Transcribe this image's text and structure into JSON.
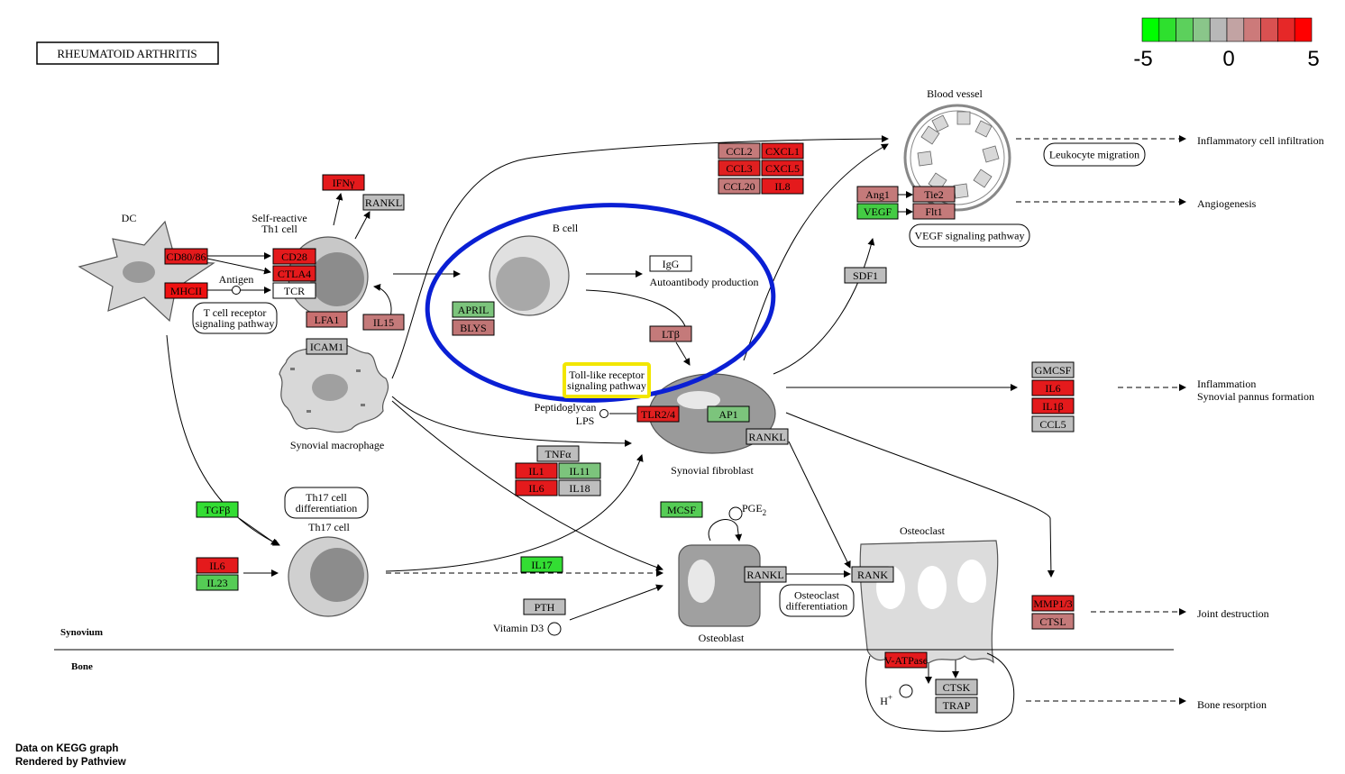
{
  "title": "RHEUMATOID  ARTHRITIS",
  "colorbar": {
    "colors": [
      "#00ff00",
      "#2ee02e",
      "#5cd05c",
      "#8ac68a",
      "#b8b8b8",
      "#c2a3a3",
      "#cc7a7a",
      "#d95151",
      "#e62828",
      "#ff0000"
    ],
    "ticks": [
      "-5",
      "0",
      "5"
    ]
  },
  "genes": [
    {
      "id": "cd80",
      "label": "CD80/86",
      "color": "#e41a1c"
    },
    {
      "id": "mhcii",
      "label": "MHCII",
      "color": "#ee1111"
    },
    {
      "id": "cd28",
      "label": "CD28",
      "color": "#e41a1c"
    },
    {
      "id": "ctla4",
      "label": "CTLA4",
      "color": "#e41a1c"
    },
    {
      "id": "tcr",
      "label": "TCR",
      "color": "#ffffff"
    },
    {
      "id": "ifng",
      "label": "IFNγ",
      "color": "#e41a1c"
    },
    {
      "id": "rankl1",
      "label": "RANKL",
      "color": "#bebebe"
    },
    {
      "id": "lfa1",
      "label": "LFA1",
      "color": "#c87070"
    },
    {
      "id": "il15",
      "label": "IL15",
      "color": "#c47a7a"
    },
    {
      "id": "icam1",
      "label": "ICAM1",
      "color": "#bebebe"
    },
    {
      "id": "april",
      "label": "APRIL",
      "color": "#7cc47c"
    },
    {
      "id": "blys",
      "label": "BLYS",
      "color": "#c07575"
    },
    {
      "id": "igg",
      "label": "IgG",
      "color": "#ffffff"
    },
    {
      "id": "ltb",
      "label": "LTβ",
      "color": "#c47a7a"
    },
    {
      "id": "ccl2",
      "label": "CCL2",
      "color": "#c47a7a"
    },
    {
      "id": "cxcl1",
      "label": "CXCL1",
      "color": "#e41a1c"
    },
    {
      "id": "ccl3",
      "label": "CCL3",
      "color": "#e02020"
    },
    {
      "id": "cxcl5",
      "label": "CXCL5",
      "color": "#e41a1c"
    },
    {
      "id": "ccl20",
      "label": "CCL20",
      "color": "#c47a7a"
    },
    {
      "id": "il8",
      "label": "IL8",
      "color": "#e41a1c"
    },
    {
      "id": "ang1",
      "label": "Ang1",
      "color": "#c47a7a"
    },
    {
      "id": "tie2",
      "label": "Tie2",
      "color": "#c47a7a"
    },
    {
      "id": "vegf",
      "label": "VEGF",
      "color": "#44cc44"
    },
    {
      "id": "flt1",
      "label": "Flt1",
      "color": "#c47a7a"
    },
    {
      "id": "sdf1",
      "label": "SDF1",
      "color": "#bebebe"
    },
    {
      "id": "gmcsf",
      "label": "GMCSF",
      "color": "#bebebe"
    },
    {
      "id": "il6a",
      "label": "IL6",
      "color": "#e41a1c"
    },
    {
      "id": "il1b",
      "label": "IL1β",
      "color": "#e41a1c"
    },
    {
      "id": "ccl5",
      "label": "CCL5",
      "color": "#bebebe"
    },
    {
      "id": "tlr24",
      "label": "TLR2/4",
      "color": "#e02020"
    },
    {
      "id": "ap1",
      "label": "AP1",
      "color": "#7cc47c"
    },
    {
      "id": "rankl2",
      "label": "RANKL",
      "color": "#bebebe"
    },
    {
      "id": "tnfa",
      "label": "TNFα",
      "color": "#bebebe"
    },
    {
      "id": "il1",
      "label": "IL1",
      "color": "#e41a1c"
    },
    {
      "id": "il11",
      "label": "IL11",
      "color": "#7cc47c"
    },
    {
      "id": "il6b",
      "label": "IL6",
      "color": "#e41a1c"
    },
    {
      "id": "il18",
      "label": "IL18",
      "color": "#bebebe"
    },
    {
      "id": "tgfb",
      "label": "TGFβ",
      "color": "#33dd33"
    },
    {
      "id": "il6c",
      "label": "IL6",
      "color": "#e41a1c"
    },
    {
      "id": "il23",
      "label": "IL23",
      "color": "#55cc55"
    },
    {
      "id": "il17",
      "label": "IL17",
      "color": "#33dd33"
    },
    {
      "id": "mcsf",
      "label": "MCSF",
      "color": "#55cc55"
    },
    {
      "id": "pth",
      "label": "PTH",
      "color": "#bebebe"
    },
    {
      "id": "rankl3",
      "label": "RANKL",
      "color": "#bebebe"
    },
    {
      "id": "rank",
      "label": "RANK",
      "color": "#bebebe"
    },
    {
      "id": "mmp",
      "label": "MMP1/3",
      "color": "#e02020"
    },
    {
      "id": "ctsl",
      "label": "CTSL",
      "color": "#c47a7a"
    },
    {
      "id": "vatpase",
      "label": "V-ATPase",
      "color": "#e41a1c"
    },
    {
      "id": "ctsk",
      "label": "CTSK",
      "color": "#bebebe"
    },
    {
      "id": "trap",
      "label": "TRAP",
      "color": "#bebebe"
    }
  ],
  "pathways": [
    {
      "id": "tcr_path",
      "label": [
        "T cell receptor",
        "signaling pathway"
      ]
    },
    {
      "id": "th17_path",
      "label": [
        "Th17 cell",
        "differentiation"
      ]
    },
    {
      "id": "leuk_path",
      "label": [
        "Leukocyte migration"
      ]
    },
    {
      "id": "vegf_path",
      "label": [
        "VEGF signaling pathway"
      ]
    },
    {
      "id": "osteo_path",
      "label": [
        "Osteoclast",
        "differentiation"
      ]
    },
    {
      "id": "tlr_path",
      "label": [
        "Toll-like receptor",
        "signaling pathway"
      ]
    }
  ],
  "labels": {
    "dc": "DC",
    "th1": [
      "Self-reactive",
      "Th1 cell"
    ],
    "antigen": "Antigen",
    "bcell": "B cell",
    "autoantibody": "Autoantibody production",
    "blood_vessel": "Blood vessel",
    "macrophage": "Synovial macrophage",
    "fibroblast": "Synovial fibroblast",
    "peptidoglycan": "Peptidoglycan",
    "lps": "LPS",
    "th17": "Th17 cell",
    "pge2": "PGE",
    "pge2_sub": "2",
    "vitd3": "Vitamin D3",
    "osteoblast": "Osteoblast",
    "osteoclast": "Osteoclast",
    "hplus": "H",
    "hplus_sup": "+",
    "synovium": "Synovium",
    "bone": "Bone",
    "inflam_infil": "Inflammatory cell infiltration",
    "angiogenesis": "Angiogenesis",
    "inflammation": [
      "Inflammation",
      "Synovial pannus formation"
    ],
    "joint": "Joint destruction",
    "bone_resorption": "Bone resorption"
  },
  "footer": {
    "line1": "Data on KEGG graph",
    "line2": "Rendered by Pathview"
  }
}
